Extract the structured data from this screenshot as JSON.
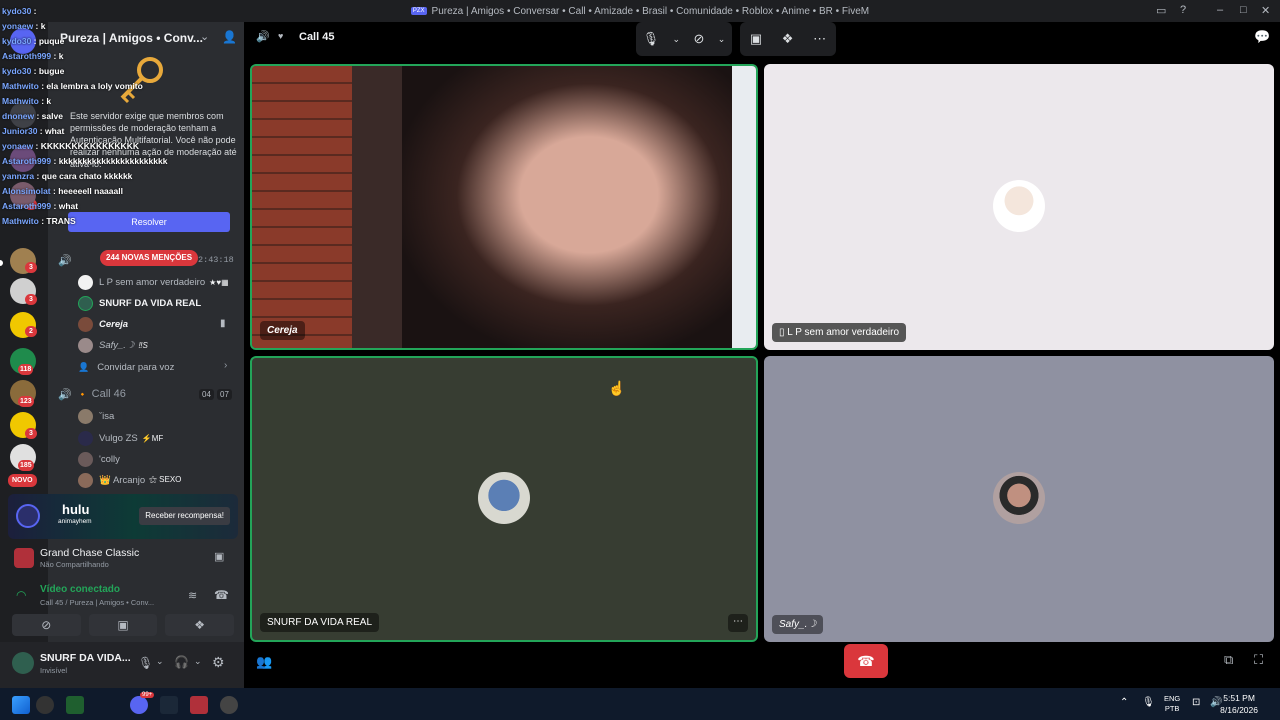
{
  "window": {
    "title": "Pureza | Amigos • Conversar • Call • Amizade • Brasil • Comunidade • Roblox • Anime • BR • FiveM",
    "badge": "PZX"
  },
  "server": {
    "name": "Pureza | Amigos • Conv..."
  },
  "notice": {
    "text": "Este servidor exige que membros com permissões de moderação tenham a Autenticação Multifatorial. Você não pode realizar nenhuma ação de moderação até ativá-lo.",
    "button": "Resolver"
  },
  "chat_overlay": [
    {
      "user": "kydo30",
      "msg": ""
    },
    {
      "user": "yonaew",
      "msg": "k"
    },
    {
      "user": "kydo30",
      "msg": "puque"
    },
    {
      "user": "Astaroth999",
      "msg": "k"
    },
    {
      "user": "kydo30",
      "msg": "bugue"
    },
    {
      "user": "Mathwito",
      "msg": "ela lembra a loly vomito"
    },
    {
      "user": "Mathwito",
      "msg": "k"
    },
    {
      "user": "dnonew",
      "msg": "salve"
    },
    {
      "user": "Junior30",
      "msg": "what"
    },
    {
      "user": "yonaew",
      "msg": "KKKKKKKKKKKKKKKK"
    },
    {
      "user": "Astaroth999",
      "msg": "kkkkkkkkkkkkkkkkkkkkkkk"
    },
    {
      "user": "yannzra",
      "msg": "que cara chato kkkkkk"
    },
    {
      "user": "Alonsimolat",
      "msg": "heeeeell naaaall"
    },
    {
      "user": "Astaroth999",
      "msg": "what"
    },
    {
      "user": "Mathwito",
      "msg": "TRANS"
    }
  ],
  "rail_badges": [
    "1",
    "3",
    "3",
    "2",
    "118",
    "123",
    "3",
    "185"
  ],
  "rail_new": "NOVO",
  "voice": {
    "mentions": "244 NOVAS MENÇÕES",
    "timer": "2:43:18",
    "call45_members": [
      {
        "name": "L P sem amor verdadeiro",
        "tag": "★♥▦"
      },
      {
        "name": "SNURF DA VIDA REAL",
        "tag": ""
      },
      {
        "name": "Cereja",
        "tag": ""
      },
      {
        "name": "Safy_.☽",
        "tag": "‼S"
      }
    ],
    "invite": "Convidar para voz",
    "call46_name": "Call 46",
    "call46_count_a": "04",
    "call46_count_b": "07",
    "call46_members": [
      {
        "name": "ˇisa",
        "tag": ""
      },
      {
        "name": "Vulgo ZS",
        "tag": "⚡MF"
      },
      {
        "name": "'colly",
        "tag": ""
      },
      {
        "name": "👑 Arcanjo",
        "tag": "⚝ SEXO"
      }
    ]
  },
  "promo": {
    "brand": "hulu",
    "sub": "animayhem",
    "button": "Receber recompensa!"
  },
  "game": {
    "name": "Grand Chase Classic",
    "status": "Não Compartilhando"
  },
  "voice_connected": {
    "title": "Vídeo conectado",
    "path": "Call 45 / Pureza | Amigos • Conv..."
  },
  "user": {
    "name": "SNURF DA VIDA...",
    "status": "Invisível"
  },
  "call": {
    "channel": "Call 45",
    "tiles": [
      {
        "name": "Cereja"
      },
      {
        "name": "L P sem amor verdadeiro"
      },
      {
        "name": "SNURF DA VIDA REAL"
      },
      {
        "name": "Safy_.☽"
      }
    ]
  },
  "taskbar": {
    "lang_a": "ENG",
    "lang_b": "PTB",
    "time": "5:51 PM",
    "date": "8/16/2026",
    "steam_badge": "99+"
  },
  "colors": {
    "accent": "#5865f2",
    "danger": "#da373c",
    "speaking": "#23a559"
  }
}
